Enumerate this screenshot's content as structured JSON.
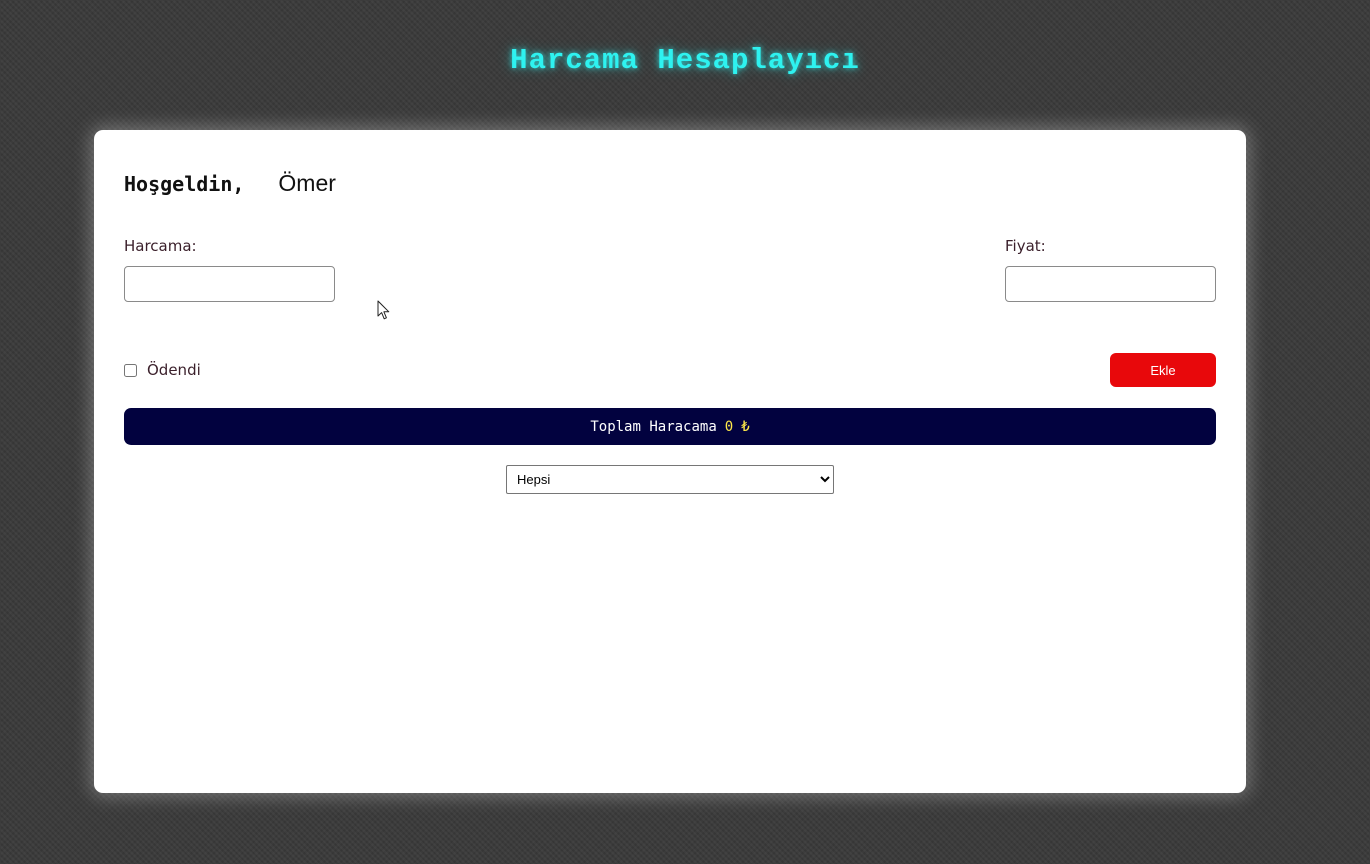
{
  "app": {
    "title": "Harcama Hesaplayıcı"
  },
  "welcome": {
    "label": "Hoşgeldin,",
    "user_name": "Ömer"
  },
  "form": {
    "expense_label": "Harcama:",
    "expense_value": "",
    "price_label": "Fiyat:",
    "price_value": "",
    "paid_label": "Ödendi",
    "paid_checked": false,
    "add_button_label": "Ekle"
  },
  "total": {
    "label": "Toplam Haracama",
    "amount": "0",
    "currency": "₺"
  },
  "filter": {
    "selected": "Hepsi",
    "options": [
      "Hepsi"
    ]
  },
  "colors": {
    "background": "#3b3b3b",
    "title": "#2ef2f0",
    "card": "#ffffff",
    "add_button": "#e8080b",
    "total_bar": "#02023f",
    "total_amount": "#ffe94a"
  },
  "icons": {
    "cursor": "mouse-pointer-icon"
  }
}
